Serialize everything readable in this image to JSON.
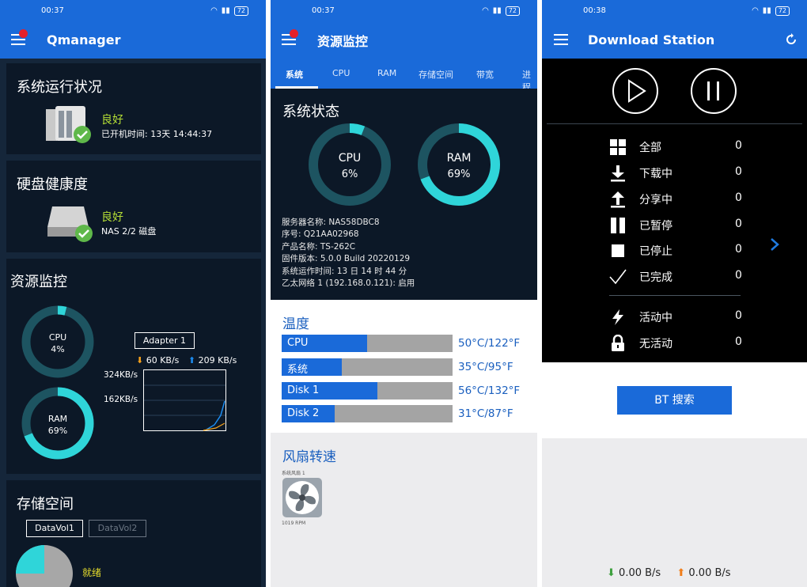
{
  "screen1": {
    "status_time": "00:37",
    "battery": "72",
    "app_title": "Qmanager",
    "system_status": {
      "title": "系统运行状况",
      "state": "良好",
      "uptime": "已开机时间: 13天 14:44:37"
    },
    "disk_health": {
      "title": "硬盘健康度",
      "state": "良好",
      "detail": "NAS 2/2 磁盘"
    },
    "resource_monitor": {
      "title": "资源监控",
      "cpu_label": "CPU",
      "cpu_value": "4%",
      "cpu_pct": 4,
      "ram_label": "RAM",
      "ram_value": "69%",
      "ram_pct": 69,
      "adapter_button": "Adapter 1",
      "download_rate": "60 KB/s",
      "upload_rate": "209 KB/s",
      "y_label_top": "324KB/s",
      "y_label_mid": "162KB/s"
    },
    "storage": {
      "title": "存储空间",
      "tabs": [
        "DataVol1",
        "DataVol2"
      ],
      "state": "就绪"
    }
  },
  "screen2": {
    "status_time": "00:37",
    "battery": "72",
    "app_title": "资源监控",
    "tabs": [
      "系统",
      "CPU",
      "RAM",
      "存储空间",
      "带宽",
      "进程"
    ],
    "system_state_title": "系统状态",
    "cpu": {
      "label": "CPU",
      "value": "6%",
      "pct": 6
    },
    "ram": {
      "label": "RAM",
      "value": "69%",
      "pct": 69
    },
    "info": {
      "server_name": "服务器名称: NAS58DBC8",
      "serial": "序号: Q21AA02968",
      "product": "产品名称: TS-262C",
      "firmware": "固件版本: 5.0.0 Build 20220129",
      "uptime": "系统运作时间: 13 日 14 时 44 分",
      "ethernet": "乙太网络 1 (192.168.0.121): 启用"
    },
    "temperature_title": "温度",
    "temperatures": [
      {
        "label": "CPU",
        "value": "50°C/122°F",
        "fill": 0.5
      },
      {
        "label": "系统",
        "value": "35°C/95°F",
        "fill": 0.35
      },
      {
        "label": "Disk 1",
        "value": "56°C/132°F",
        "fill": 0.56
      },
      {
        "label": "Disk 2",
        "value": "31°C/87°F",
        "fill": 0.31
      }
    ],
    "fan_title": "风扇转速",
    "fan_name": "系统风扇 1",
    "fan_rpm": "1019 RPM"
  },
  "screen3": {
    "status_time": "00:38",
    "battery": "72",
    "app_title": "Download Station",
    "categories": [
      {
        "icon": "grid-icon",
        "label": "全部",
        "count": "0"
      },
      {
        "icon": "download-arrow-icon",
        "label": "下载中",
        "count": "0"
      },
      {
        "icon": "upload-arrow-icon",
        "label": "分享中",
        "count": "0"
      },
      {
        "icon": "pause-bars-icon",
        "label": "已暂停",
        "count": "0"
      },
      {
        "icon": "stop-square-icon",
        "label": "已停止",
        "count": "0"
      },
      {
        "icon": "checkmark-icon",
        "label": "已完成",
        "count": "0"
      }
    ],
    "activity": [
      {
        "icon": "lightning-icon",
        "label": "活动中",
        "count": "0"
      },
      {
        "icon": "padlock-icon",
        "label": "无活动",
        "count": "0"
      }
    ],
    "bt_search_button": "BT 搜索",
    "download_speed": "0.00 B/s",
    "upload_speed": "0.00 B/s"
  },
  "colors": {
    "accent": "#1a6ad9",
    "ring": "#2fd5d9",
    "ring_track": "#1d5461",
    "good": "#b6df35",
    "dark": "#0c1827"
  }
}
